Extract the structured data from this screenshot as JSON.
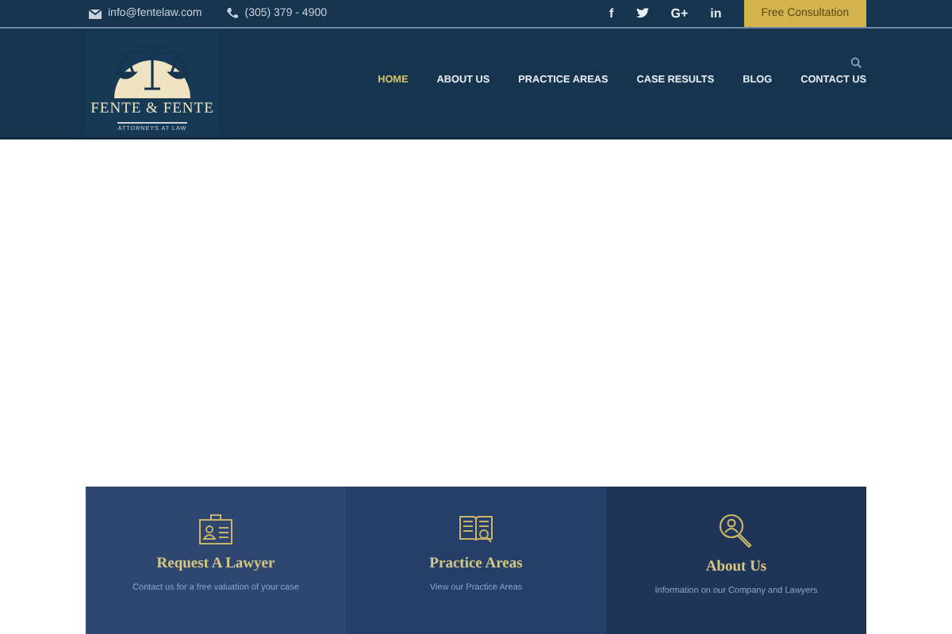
{
  "topbar": {
    "email": "info@fentelaw.com",
    "phone": "(305) 379 - 4900",
    "social": [
      {
        "kind": "text",
        "label": "f"
      },
      {
        "kind": "bird"
      },
      {
        "kind": "text",
        "label": "G+"
      },
      {
        "kind": "text",
        "label": "in"
      }
    ],
    "cta": "Free Consultation"
  },
  "logo": {
    "name": "FENTE & FENTE",
    "tagline": "ATTORNEYS AT LAW"
  },
  "nav": [
    {
      "label": "HOME",
      "selected": true
    },
    {
      "label": "ABOUT US",
      "selected": false
    },
    {
      "label": "PRACTICE AREAS",
      "selected": false
    },
    {
      "label": "CASE RESULTS",
      "selected": false
    },
    {
      "label": "BLOG",
      "selected": false
    },
    {
      "label": "CONTACT US",
      "selected": false
    }
  ],
  "cards": [
    {
      "kind": "badge",
      "title": "Request A Lawyer",
      "text": "Contact us for a free valuation of your case",
      "color": "#2e4670"
    },
    {
      "kind": "book",
      "title": "Practice Areas",
      "text": "View our Practice Areas",
      "color": "#263f68"
    },
    {
      "kind": "person-search",
      "title": "About Us",
      "text": "Information on our Company and Lawyers",
      "color": "#1f3558"
    }
  ]
}
